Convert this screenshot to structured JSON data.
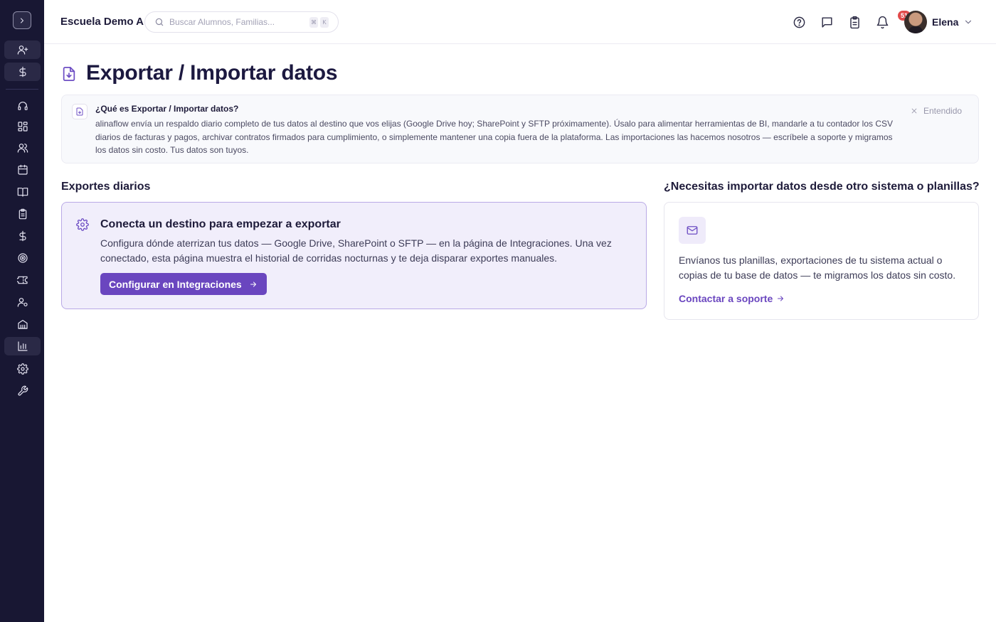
{
  "header": {
    "school_name": "Escuela Demo A",
    "search_placeholder": "Buscar Alumnos, Familias...",
    "shortcut_keys": [
      "⌘",
      "K"
    ],
    "notification_badge": "51",
    "user_name": "Elena"
  },
  "sidebar": {
    "items": [
      {
        "icon": "chevron-right-icon",
        "label": "toggle"
      },
      {
        "icon": "user-plus-icon",
        "highlight": true
      },
      {
        "icon": "dollar-icon",
        "highlight": true
      },
      {
        "icon": "headset-icon"
      },
      {
        "icon": "dashboard-icon"
      },
      {
        "icon": "users-icon"
      },
      {
        "icon": "calendar-icon"
      },
      {
        "icon": "book-icon"
      },
      {
        "icon": "clipboard-icon"
      },
      {
        "icon": "dollar-icon"
      },
      {
        "icon": "target-icon"
      },
      {
        "icon": "ticket-icon"
      },
      {
        "icon": "user-settings-icon"
      },
      {
        "icon": "building-icon"
      },
      {
        "icon": "bar-chart-icon",
        "active": true
      },
      {
        "icon": "gear-icon"
      },
      {
        "icon": "wrench-icon"
      }
    ]
  },
  "page": {
    "title": "Exportar / Importar datos"
  },
  "info": {
    "title": "¿Qué es Exportar / Importar datos?",
    "body": "alinaflow envía un respaldo diario completo de tus datos al destino que vos elijas (Google Drive hoy; SharePoint y SFTP próximamente). Úsalo para alimentar herramientas de BI, mandarle a tu contador los CSV diarios de facturas y pagos, archivar contratos firmados para cumplimiento, o simplemente mantener una copia fuera de la plataforma. Las importaciones las hacemos nosotros — escríbele a soporte y migramos los datos sin costo. Tus datos son tuyos.",
    "dismiss_label": "Entendido"
  },
  "exports": {
    "section_title": "Exportes diarios",
    "card_title": "Conecta un destino para empezar a exportar",
    "card_description": "Configura dónde aterrizan tus datos — Google Drive, SharePoint o SFTP — en la página de Integraciones. Una vez conectado, esta página muestra el historial de corridas nocturnas y te deja disparar exportes manuales.",
    "button_label": "Configurar en Integraciones"
  },
  "imports": {
    "section_title": "¿Necesitas importar datos desde otro sistema o planillas?",
    "description": "Envíanos tus planillas, exportaciones de tu sistema actual o copias de tu base de datos — te migramos los datos sin costo.",
    "link_label": "Contactar a soporte"
  },
  "colors": {
    "sidebar_bg": "#181733",
    "accent": "#6a46bf",
    "accent_soft": "#f1eefb",
    "badge": "#e24b4b"
  }
}
